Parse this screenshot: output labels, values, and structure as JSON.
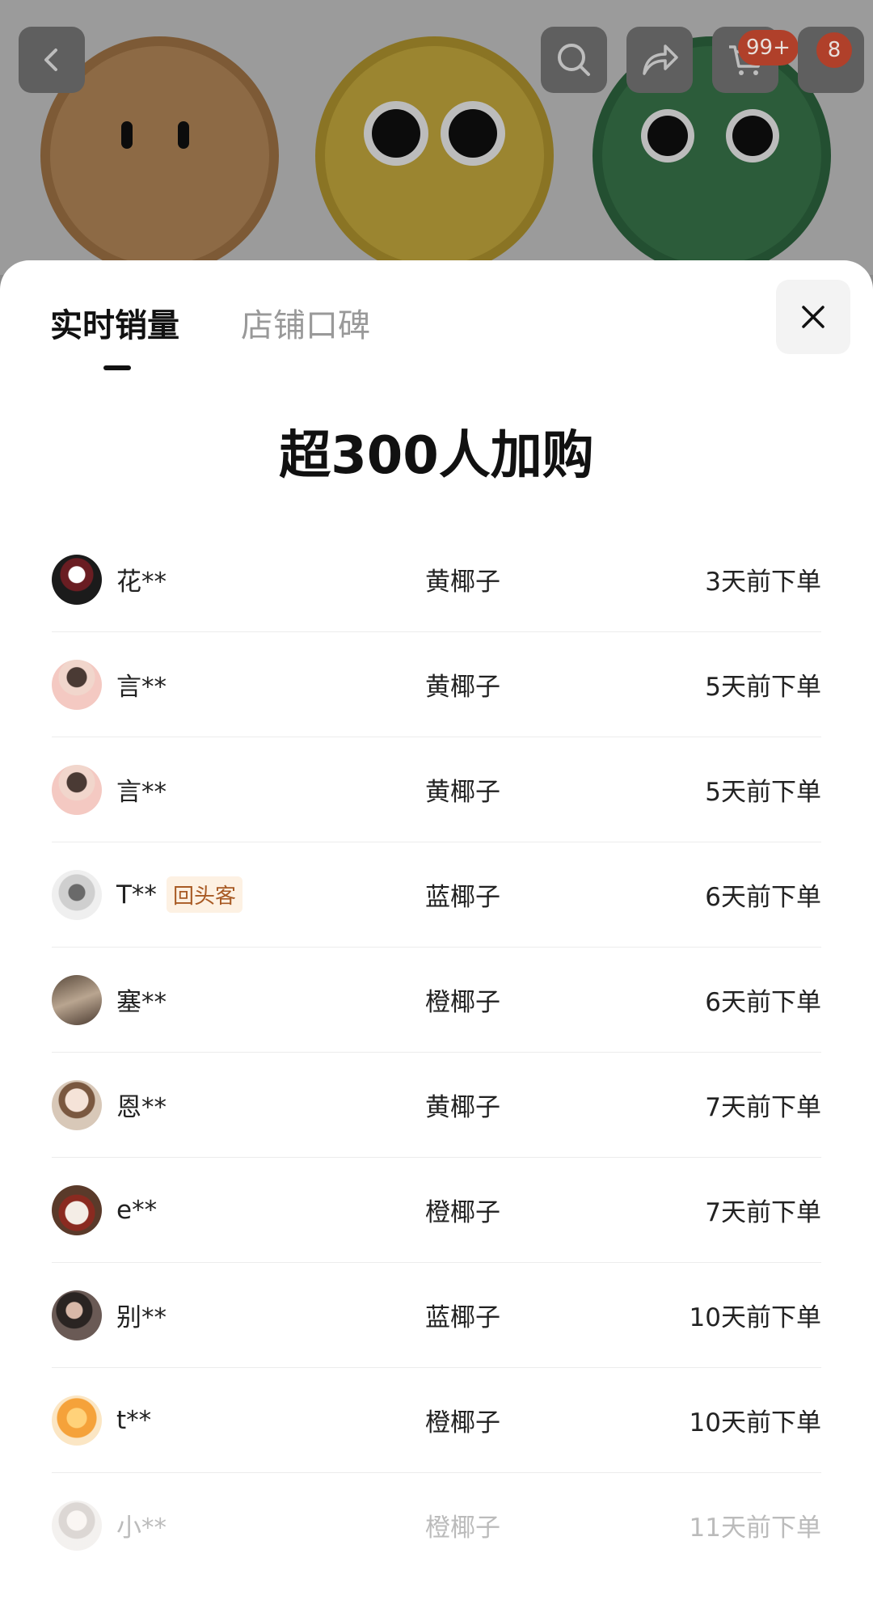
{
  "topbar": {
    "cart_badge": "99+",
    "message_badge": "8",
    "icons": [
      "back-icon",
      "search-icon",
      "share-icon",
      "cart-icon",
      "more-icon"
    ]
  },
  "tabs": [
    {
      "label": "实时销量",
      "active": true
    },
    {
      "label": "店铺口碑",
      "active": false
    }
  ],
  "headline": "超300人加购",
  "buyers": [
    {
      "name": "花**",
      "variant": "黄椰子",
      "time": "3天前下单",
      "tag": ""
    },
    {
      "name": "言**",
      "variant": "黄椰子",
      "time": "5天前下单",
      "tag": ""
    },
    {
      "name": "言**",
      "variant": "黄椰子",
      "time": "5天前下单",
      "tag": ""
    },
    {
      "name": "T**",
      "variant": "蓝椰子",
      "time": "6天前下单",
      "tag": "回头客"
    },
    {
      "name": "塞**",
      "variant": "橙椰子",
      "time": "6天前下单",
      "tag": ""
    },
    {
      "name": "恩**",
      "variant": "黄椰子",
      "time": "7天前下单",
      "tag": ""
    },
    {
      "name": "e**",
      "variant": "橙椰子",
      "time": "7天前下单",
      "tag": ""
    },
    {
      "name": "别**",
      "variant": "蓝椰子",
      "time": "10天前下单",
      "tag": ""
    },
    {
      "name": "t**",
      "variant": "橙椰子",
      "time": "10天前下单",
      "tag": ""
    },
    {
      "name": "小**",
      "variant": "橙椰子",
      "time": "11天前下单",
      "tag": ""
    }
  ],
  "colors": {
    "accent_badge": "#e0542f",
    "returning_tag_text": "#a85a24",
    "returning_tag_bg": "#fdf1e3"
  }
}
